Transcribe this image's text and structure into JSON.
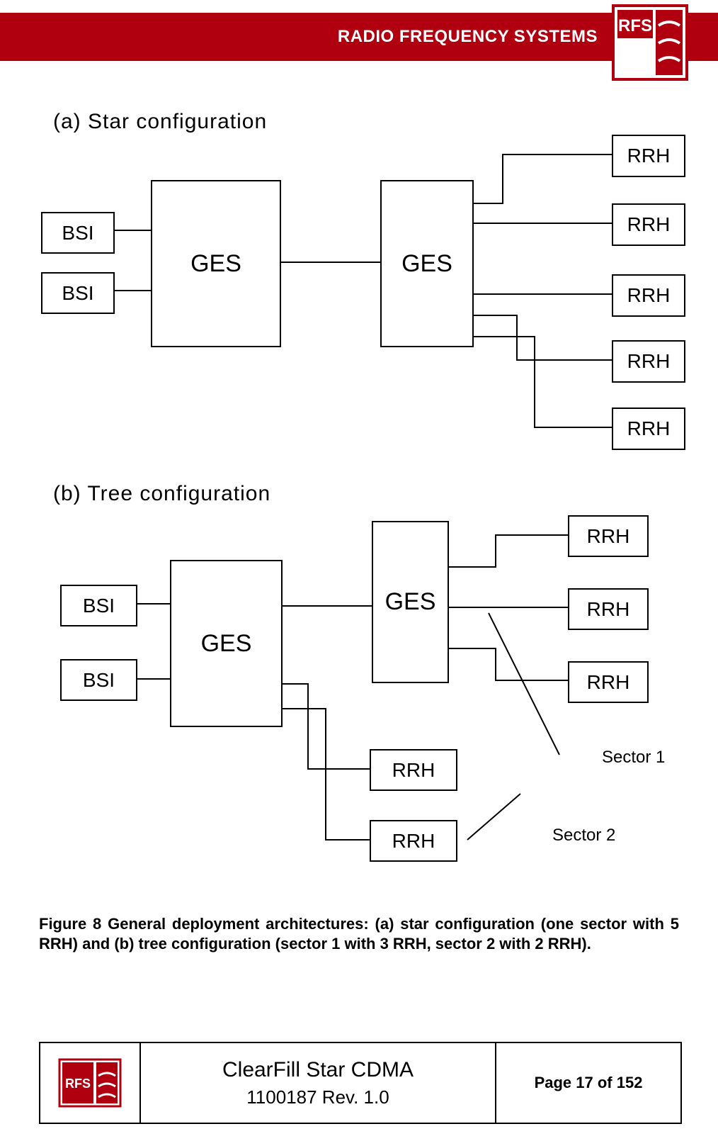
{
  "header": {
    "tagline": "RADIO FREQUENCY SYSTEMS",
    "logo_text": "RFS"
  },
  "diagram_a": {
    "title": "(a) Star configuration",
    "bsi": "BSI",
    "ges": "GES",
    "rrh": "RRH"
  },
  "diagram_b": {
    "title": "(b) Tree configuration",
    "bsi": "BSI",
    "ges": "GES",
    "rrh": "RRH",
    "sector1": "Sector 1",
    "sector2": "Sector 2"
  },
  "figure_caption": "Figure 8 General deployment architectures: (a) star configuration (one sector with 5 RRH) and (b) tree configuration (sector 1 with 3 RRH, sector 2 with 2 RRH).",
  "footer": {
    "logo_text": "RFS",
    "title": "ClearFill Star CDMA",
    "rev": "1100187 Rev. 1.0",
    "page": "Page 17 of 152"
  }
}
